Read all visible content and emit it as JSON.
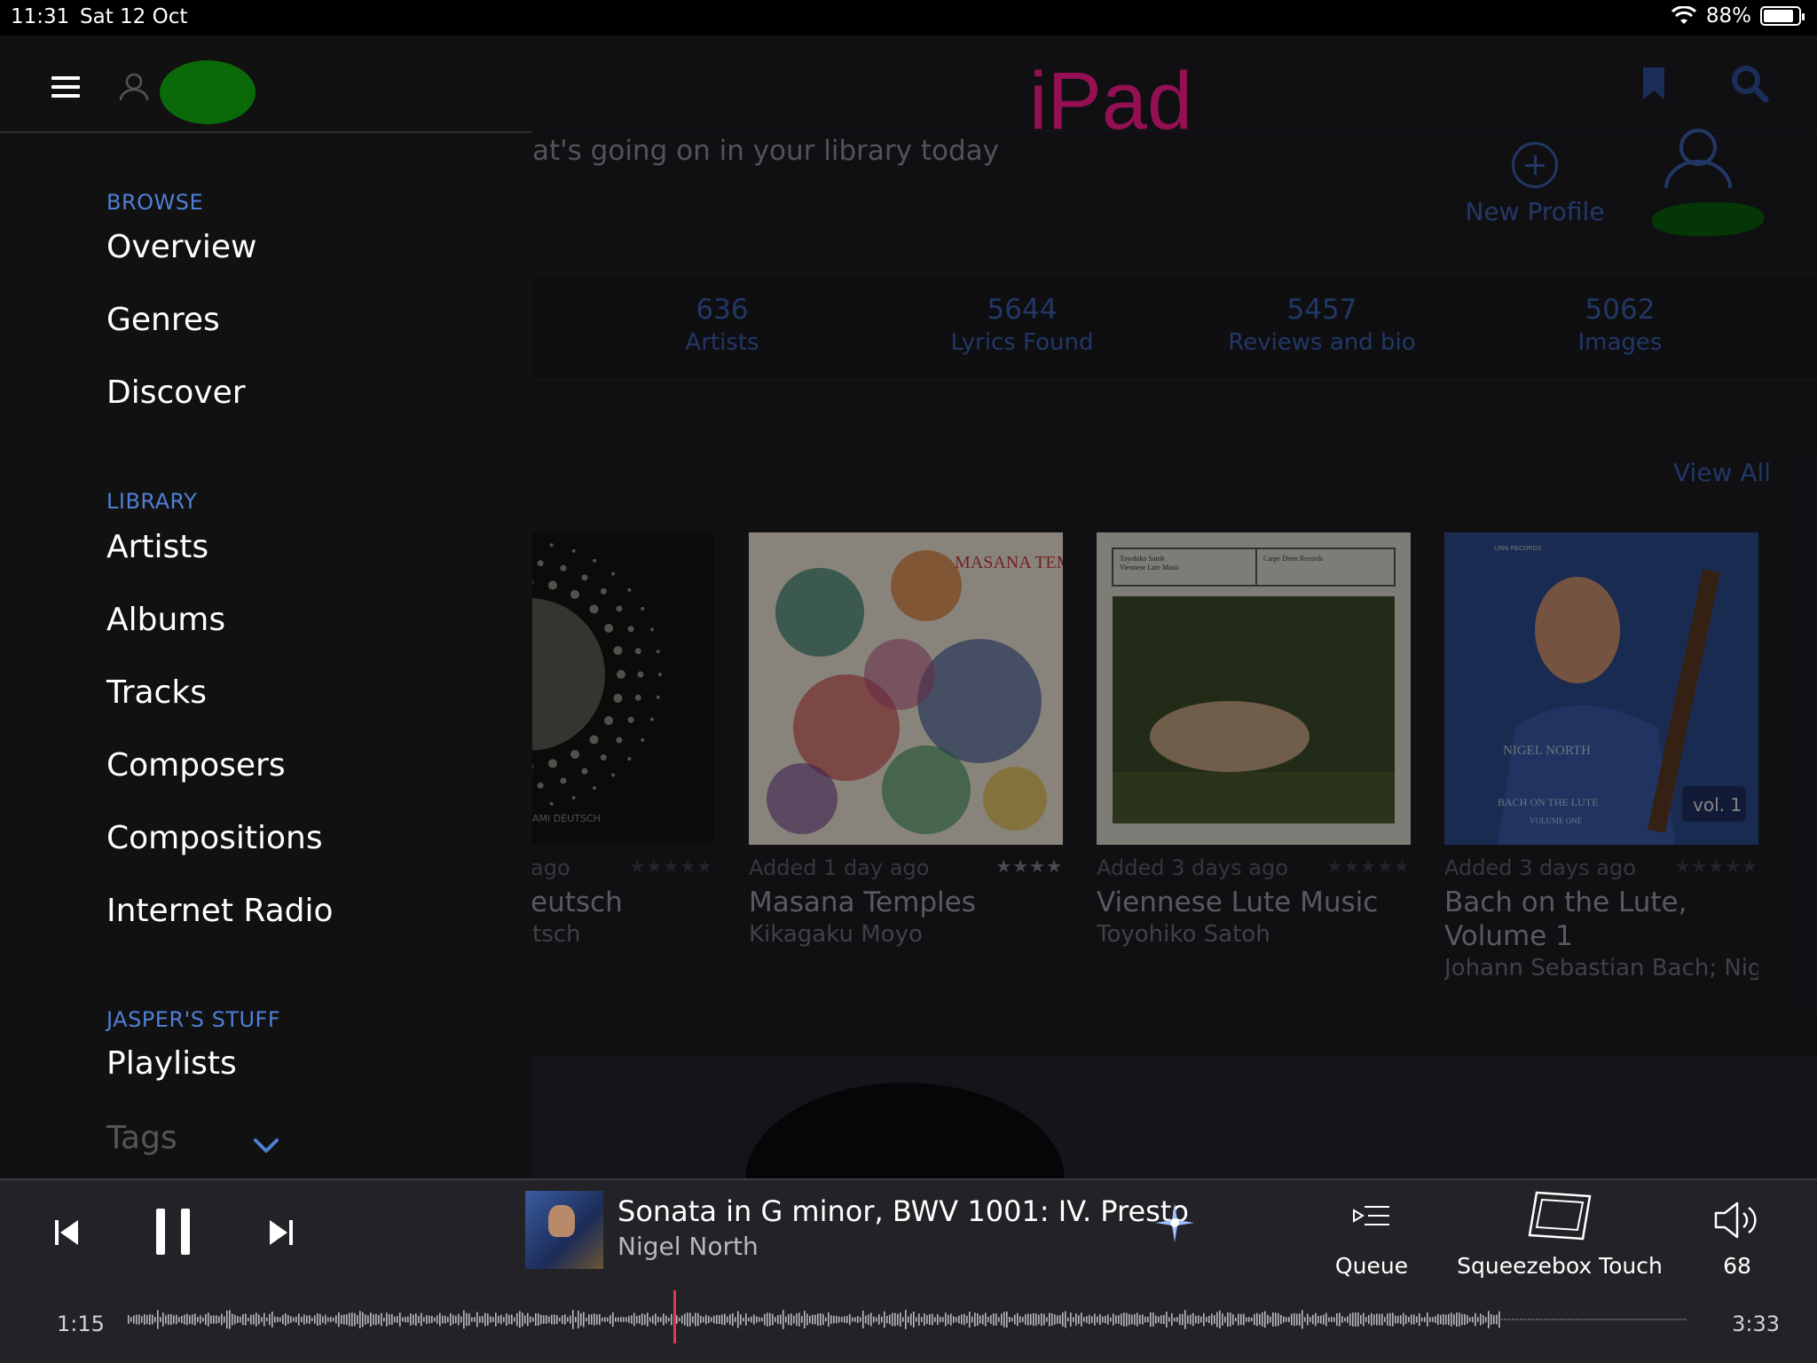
{
  "status_bar": {
    "time": "11:31",
    "date": "Sat 12 Oct",
    "battery": "88%",
    "battery_level": 0.88
  },
  "header": {
    "title": "iPad"
  },
  "welcome": {
    "text": "at's going on in your library today"
  },
  "new_profile": {
    "label": "New Profile"
  },
  "stats": [
    {
      "value": "636",
      "label": "Artists"
    },
    {
      "value": "5644",
      "label": "Lyrics Found"
    },
    {
      "value": "5457",
      "label": "Reviews and bio"
    },
    {
      "value": "5062",
      "label": "Images"
    }
  ],
  "recent": {
    "view_all": "View All"
  },
  "albums": [
    {
      "added": "ago",
      "stars": "★★★★★",
      "rating": 0,
      "title": "eutsch",
      "artist": "tsch",
      "cover_text": "AMI DEUTSCH"
    },
    {
      "added": "Added 1 day ago",
      "stars": "★★★★",
      "rating": 4,
      "title": "Masana Temples",
      "artist": "Kikagaku Moyo",
      "cover_text": "MASANA TEMPLES"
    },
    {
      "added": "Added 3 days ago",
      "stars": "★★★★★",
      "rating": 0,
      "title": "Viennese Lute Music",
      "artist": "Toyohiko Satoh",
      "cover_text_left": "Toyohiko Satoh",
      "cover_text_left2": "Viennese Lute Music",
      "cover_text_right": "Carpe Diem Records"
    },
    {
      "added": "Added 3 days ago",
      "stars": "★★★★★",
      "rating": 0,
      "title": "Bach on the Lute, Volume 1",
      "title_line1": "Bach on the Lute,",
      "title_line2": "Volume 1",
      "artist": "Johann Sebastian Bach; Nige",
      "cover_label": "NIGEL NORTH",
      "cover_sub": "BACH ON THE LUTE",
      "cover_vol_text": "VOLUME ONE",
      "cover_top": "LINN RECORDS",
      "cover_vol": "vol. 1"
    }
  ],
  "drawer": {
    "sections": [
      {
        "header": "BROWSE",
        "items": [
          "Overview",
          "Genres",
          "Discover"
        ]
      },
      {
        "header": "LIBRARY",
        "items": [
          "Artists",
          "Albums",
          "Tracks",
          "Composers",
          "Compositions",
          "Internet Radio"
        ]
      },
      {
        "header": "JASPER'S STUFF",
        "items": [
          "Playlists",
          "Tags"
        ]
      }
    ]
  },
  "player": {
    "track_title": "Sonata in G minor, BWV 1001: IV. Presto",
    "artist": "Nigel North",
    "queue_label": "Queue",
    "device_label": "Squeezebox Touch",
    "volume": "68",
    "elapsed": "1:15",
    "duration": "3:33",
    "progress": 0.352
  },
  "colors": {
    "accent": "#4f7fd6",
    "ipad_title": "#ff1c8d",
    "playhead": "#e0375a",
    "waveform_played": "#6d8fd8",
    "waveform_rest": "#b8bac0"
  }
}
